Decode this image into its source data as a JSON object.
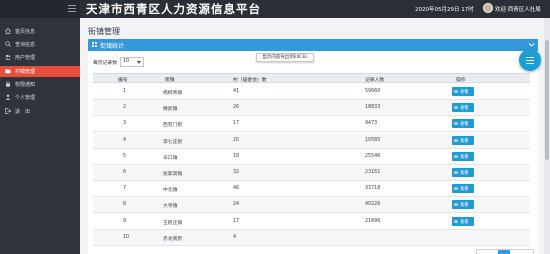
{
  "header": {
    "title": "天津市西青区人力资源信息平台",
    "date": "2020年05月29日 17时",
    "user": "欢迎 西青区人社局"
  },
  "sidebar": {
    "items": [
      {
        "label": "首页信息",
        "icon": "home-icon",
        "active": false
      },
      {
        "label": "查询信息",
        "icon": "search-icon",
        "active": false
      },
      {
        "label": "用户管理",
        "icon": "user-group-icon",
        "active": false
      },
      {
        "label": "村镇管理",
        "icon": "folder-icon",
        "active": true
      },
      {
        "label": "权限通知",
        "icon": "lock-icon",
        "active": false
      },
      {
        "label": "个人管理",
        "icon": "person-icon",
        "active": false
      },
      {
        "label": "退　出",
        "icon": "logout-icon",
        "active": false
      }
    ]
  },
  "main": {
    "page_title": "街镇管理",
    "panel_title": "街镇统计",
    "export_tip": "显示内容导出到EXCEL",
    "per_page_label": "每页记录数",
    "per_page_value": "10",
    "columns": [
      "编号",
      "街镇",
      "村（居委会）数",
      "记录人数",
      "操作"
    ],
    "view_label": "查看",
    "rows": [
      {
        "id": "1",
        "town": "杨柳青镇",
        "villages": "41",
        "records": "59660"
      },
      {
        "id": "2",
        "town": "精武镇",
        "villages": "26",
        "records": "18833"
      },
      {
        "id": "3",
        "town": "西营门街",
        "villages": "17",
        "records": "9473"
      },
      {
        "id": "4",
        "town": "李七庄街",
        "villages": "20",
        "records": "10585"
      },
      {
        "id": "5",
        "town": "辛口镇",
        "villages": "18",
        "records": "25546"
      },
      {
        "id": "6",
        "town": "张家窝镇",
        "villages": "32",
        "records": "23161"
      },
      {
        "id": "7",
        "town": "中北镇",
        "villages": "46",
        "records": "33718"
      },
      {
        "id": "8",
        "town": "大寺镇",
        "villages": "24",
        "records": "40226"
      },
      {
        "id": "9",
        "town": "王稳庄镇",
        "villages": "17",
        "records": "21696"
      },
      {
        "id": "10",
        "town": "赤龙南街",
        "villages": "4",
        "records": ""
      }
    ]
  },
  "colors": {
    "topbar": "#2b2f36",
    "sidebar": "#2f343b",
    "active": "#e84c3d",
    "accent": "#3498db",
    "button": "#1f9bd6"
  }
}
